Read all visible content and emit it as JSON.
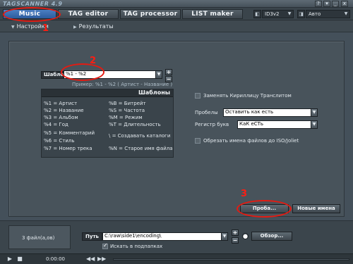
{
  "app": {
    "title": "TAGSCANNER 4.9"
  },
  "window_buttons": [
    "?",
    "▾",
    "_",
    "x"
  ],
  "main_tabs": [
    {
      "label": "Music renamer",
      "active": true
    },
    {
      "label": "TAG editor",
      "active": false
    },
    {
      "label": "TAG processor",
      "active": false
    },
    {
      "label": "LIST maker",
      "active": false
    }
  ],
  "tag_version": {
    "value": "ID3v2"
  },
  "encoding": {
    "value": "Авто"
  },
  "sub_tabs": [
    {
      "label": "Настройки",
      "active": true
    },
    {
      "label": "Результаты",
      "active": false
    }
  ],
  "template": {
    "label": "Шаблон",
    "value": "%1 - %2",
    "example": "Пример: %1 - %2 ( Артист - Название )",
    "list_title": "Шаблоны",
    "left": [
      "%1 = Артист",
      "%2 = Название",
      "%3 = Альбом",
      "%4 = Год",
      "%5 = Комментарий",
      "%6 = Стиль",
      "%7 = Номер трека"
    ],
    "right": [
      "%B = Битрейт",
      "%S = Частота",
      "%M = Режим",
      "%T = Длительность",
      "",
      "\\ = Создавать каталоги",
      "%N = Старое имя файла"
    ]
  },
  "options": {
    "replace_cyrillic": {
      "label": "Заменять Кириллицу Транслитом",
      "checked": false
    },
    "spaces": {
      "label": "Пробелы",
      "value": "Оставить как есть"
    },
    "case": {
      "label": "Регистр букв",
      "value": "КаК еСТь"
    },
    "truncate": {
      "label": "Обрезать имена файлов до ISO/Joliet",
      "checked": false
    }
  },
  "buttons": {
    "test": "Проба...",
    "new_names": "Новые имена",
    "browse": "Обзор..."
  },
  "bottom": {
    "files_count": "3 файл(а,ов)",
    "path_label": "Путь",
    "path_value": "C:\\raw\\side1\\encoding\\",
    "subfolders_label": "Искать в подпапках",
    "subfolders_checked": true
  },
  "status": {
    "time": "0:00:00"
  },
  "annotations": [
    "1",
    "2",
    "3"
  ],
  "colors": {
    "annotation": "#e41b12",
    "active_tab": "#2c5c9e"
  }
}
